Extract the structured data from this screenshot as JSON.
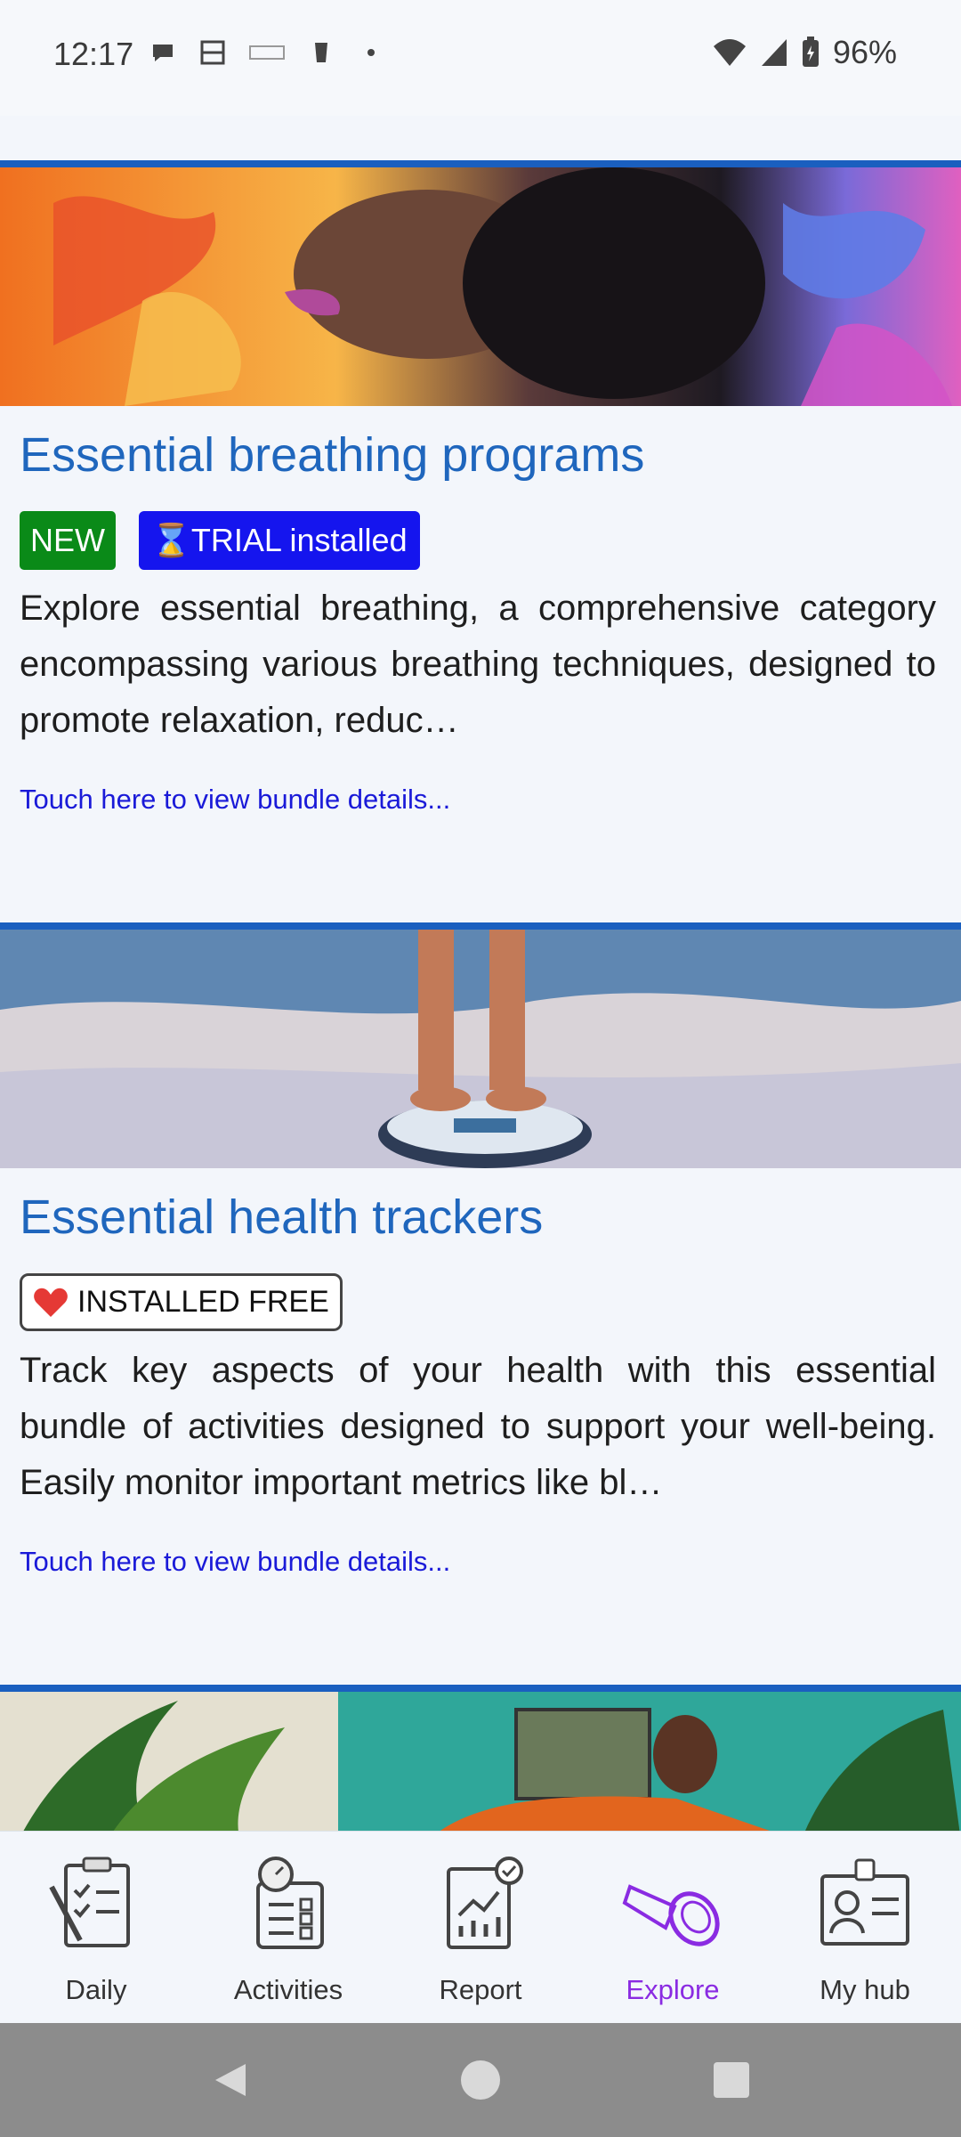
{
  "status_bar": {
    "time": "12:17",
    "battery": "96%"
  },
  "cards": [
    {
      "title": "Essential breathing programs",
      "badges": [
        "NEW",
        "⌛TRIAL installed"
      ],
      "description": "Explore essential breathing, a comprehensive category encompassing various breathing techniques, designed to promote relaxation, reduc…",
      "link": "Touch here to view bundle details..."
    },
    {
      "title": "Essential health trackers",
      "badges": [
        "❤️ INSTALLED FREE"
      ],
      "badge_text": "INSTALLED FREE",
      "description": "Track key aspects of your health with this essential bundle of activities designed to support your well-being. Easily monitor important metrics like bl…",
      "link": "Touch here to view bundle details..."
    }
  ],
  "bottom_nav": {
    "items": [
      {
        "label": "Daily",
        "icon": "clipboard-icon"
      },
      {
        "label": "Activities",
        "icon": "checklist-timer-icon"
      },
      {
        "label": "Report",
        "icon": "chart-report-icon"
      },
      {
        "label": "Explore",
        "icon": "flashlight-icon"
      },
      {
        "label": "My hub",
        "icon": "id-card-icon"
      }
    ],
    "active": "Explore",
    "active_color": "#8a2be2"
  },
  "colors": {
    "accent_bar": "#1a5fbf",
    "title": "#1f66bd",
    "new_badge": "#0a8a18",
    "trial_badge": "#1515ee",
    "link": "#1a1ad8"
  }
}
